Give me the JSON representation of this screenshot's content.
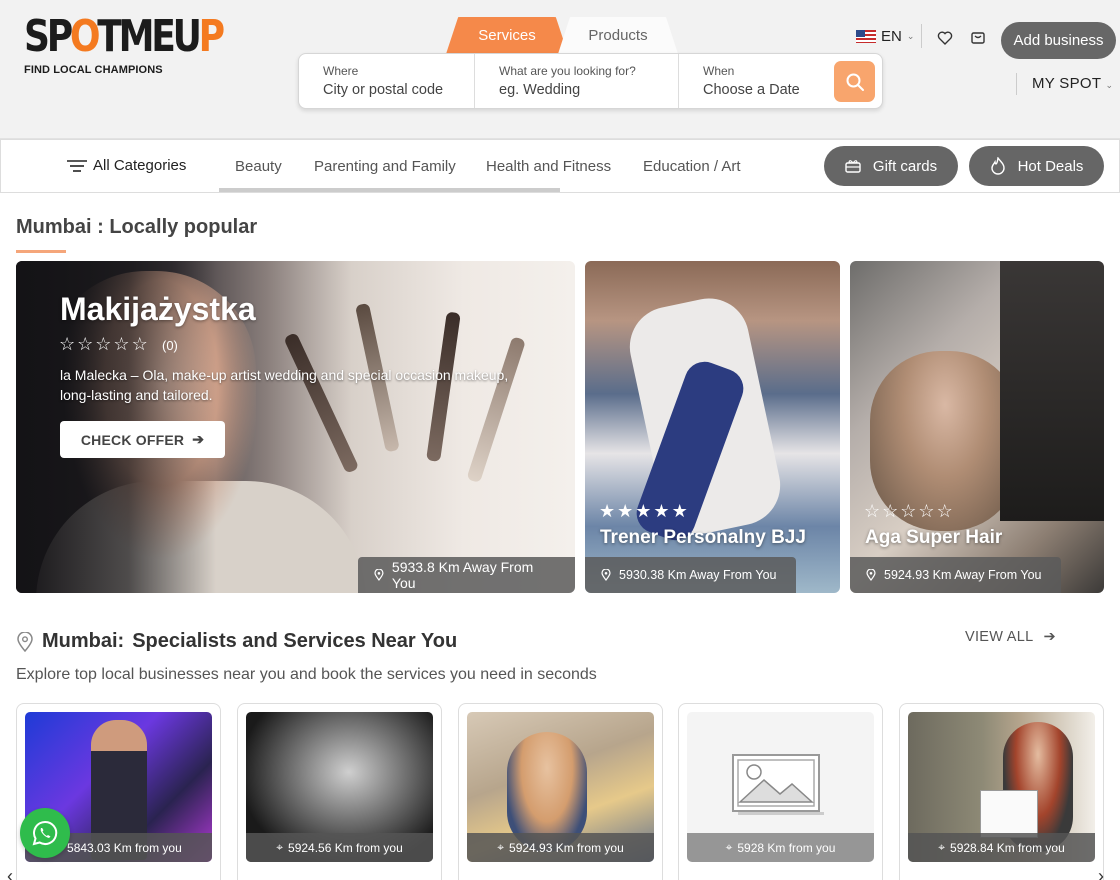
{
  "brand": {
    "logo_text_a": "SP",
    "logo_text_o": "O",
    "logo_text_b": "TMEU",
    "logo_text_p": "P",
    "tagline": "FIND LOCAL CHAMPIONS",
    "accent": "#f47a20"
  },
  "header": {
    "tabs": [
      {
        "label": "Services",
        "active": true
      },
      {
        "label": "Products",
        "active": false
      }
    ],
    "search": {
      "where_label": "Where",
      "where_placeholder": "City or postal code",
      "what_label": "What are you looking for?",
      "what_placeholder": "eg. Wedding",
      "when_label": "When",
      "when_placeholder": "Choose a Date"
    },
    "language": "EN",
    "add_business": "Add business",
    "my_spot": "MY SPOT"
  },
  "categories": {
    "all_label": "All Categories",
    "items": [
      "Beauty",
      "Parenting and Family",
      "Health and Fitness",
      "Education / Art"
    ],
    "gift_cards": "Gift cards",
    "hot_deals": "Hot Deals"
  },
  "popular": {
    "title": "Mumbai : Locally popular",
    "featured": {
      "title": "Makijażystka",
      "rating_count": "(0)",
      "description": "la Malecka – Ola, make-up artist wedding and special occasion makeup, long-lasting and tailored.",
      "cta": "CHECK OFFER",
      "distance": "5933.8 Km Away From You"
    },
    "cards": [
      {
        "title": "Trener Personalny BJJ",
        "distance": "5930.38 Km Away From You",
        "rating": 5
      },
      {
        "title": "Aga Super Hair",
        "distance": "5924.93 Km Away From You",
        "rating": 0
      }
    ]
  },
  "specialists": {
    "city": "Mumbai:",
    "title": "Specialists and Services Near You",
    "view_all": "VIEW ALL",
    "subtitle": "Explore top local businesses near you and book the services you need in seconds",
    "items": [
      {
        "distance": "5843.03 Km from you"
      },
      {
        "distance": "5924.56 Km from you"
      },
      {
        "distance": "5924.93 Km from you"
      },
      {
        "distance": "5928 Km from you"
      },
      {
        "distance": "5928.84 Km from you"
      }
    ]
  }
}
